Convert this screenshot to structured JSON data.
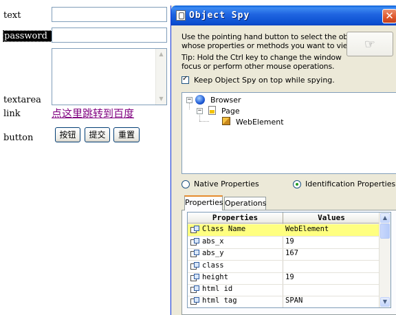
{
  "form": {
    "text_label": "text",
    "password_label": "password",
    "textarea_label": "textarea",
    "link_label": "link",
    "link_text": "点这里跳转到百度",
    "button_label": "button",
    "buttons": [
      "按钮",
      "提交",
      "重置"
    ]
  },
  "spy": {
    "title": "Object Spy",
    "instructions": [
      "Use the pointing hand button to select the object",
      "whose properties or methods you want to view.",
      "Tip: Hold the Ctrl key to change the window",
      "focus or perform other mouse operations."
    ],
    "keep_on_top_label": "Keep Object Spy on top while spying.",
    "keep_on_top_checked": true,
    "tree": [
      {
        "label": "Browser",
        "icon": "browser-globe-icon"
      },
      {
        "label": "Page",
        "icon": "page-icon"
      },
      {
        "label": "WebElement",
        "icon": "web-element-cube-icon"
      }
    ],
    "radio_native": "Native Properties",
    "radio_identification": "Identification Properties",
    "selected_radio": "Identification Properties",
    "tabs": [
      "Properties",
      "Operations"
    ],
    "active_tab": "Properties",
    "grid_headers": [
      "Properties",
      "Values"
    ],
    "rows": [
      {
        "name": "Class Name",
        "value": "WebElement",
        "selected": true
      },
      {
        "name": "abs_x",
        "value": "19"
      },
      {
        "name": "abs_y",
        "value": "167"
      },
      {
        "name": "class",
        "value": ""
      },
      {
        "name": "height",
        "value": "19"
      },
      {
        "name": "html id",
        "value": ""
      },
      {
        "name": "html tag",
        "value": "SPAN"
      }
    ],
    "colors": {
      "title_bar": "#0b4fd0",
      "selected_row": "#ffff80",
      "link_visited": "#800080",
      "window_bg": "#ece9d8"
    }
  }
}
